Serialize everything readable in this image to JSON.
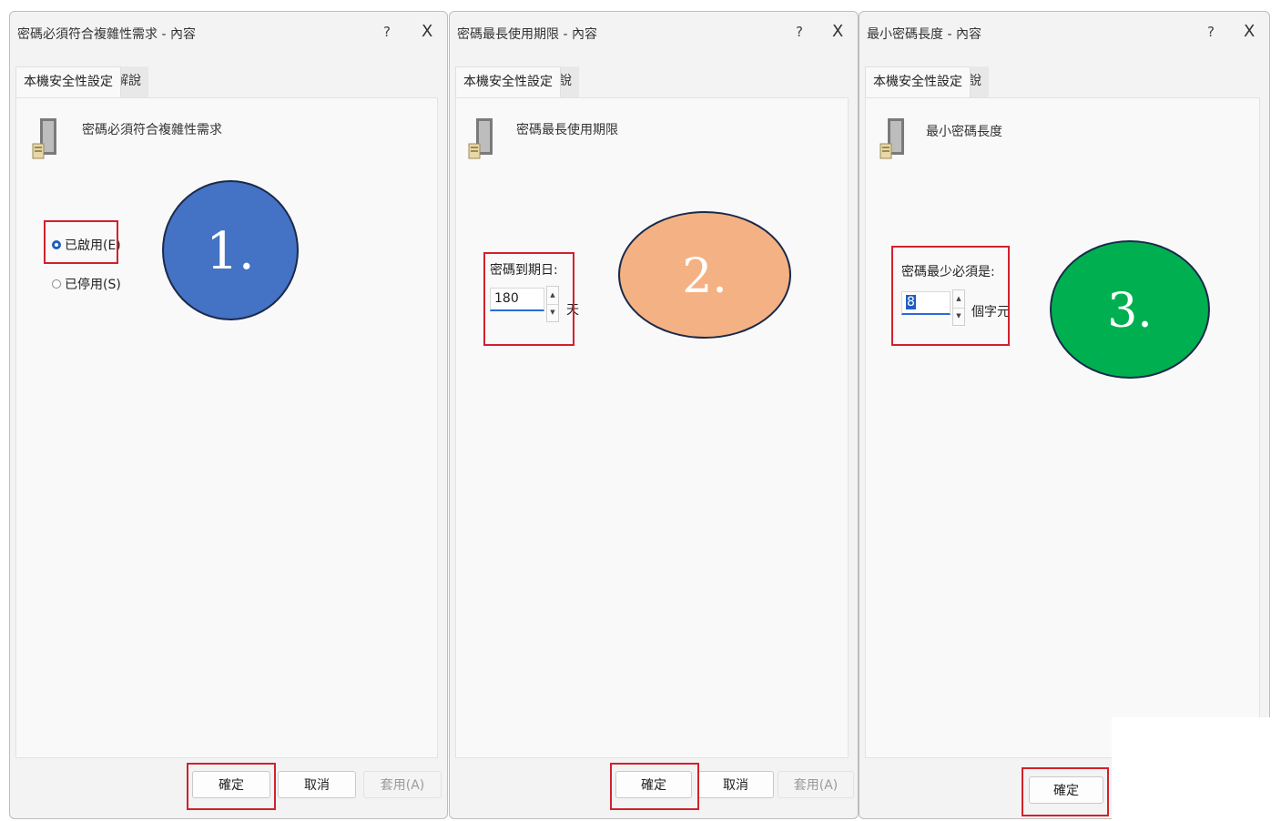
{
  "dialogs": [
    {
      "title": "密碼必須符合複雜性需求 - 內容",
      "help": "?",
      "close": "X",
      "tabs": [
        "本機安全性設定",
        "解說"
      ],
      "policy_name": "密碼必須符合複雜性需求",
      "options": [
        {
          "label": "已啟用(E)",
          "checked": true
        },
        {
          "label": "已停用(S)",
          "checked": false
        }
      ],
      "buttons": {
        "ok": "確定",
        "cancel": "取消",
        "apply": "套用(A)"
      },
      "marker": {
        "label": "1.",
        "color": "#4472c4"
      }
    },
    {
      "title": "密碼最長使用期限 - 內容",
      "help": "?",
      "close": "X",
      "tabs": [
        "本機安全性設定",
        "解說"
      ],
      "policy_name": "密碼最長使用期限",
      "field_label": "密碼到期日:",
      "field_value": "180",
      "unit": "天",
      "buttons": {
        "ok": "確定",
        "cancel": "取消",
        "apply": "套用(A)"
      },
      "marker": {
        "label": "2.",
        "color": "#f4b183"
      }
    },
    {
      "title": "最小密碼長度 - 內容",
      "help": "?",
      "close": "X",
      "tabs": [
        "本機安全性設定",
        "解說"
      ],
      "policy_name": "最小密碼長度",
      "field_label": "密碼最少必須是:",
      "field_value": "8",
      "unit": "個字元",
      "buttons": {
        "ok": "確定"
      },
      "marker": {
        "label": "3.",
        "color": "#00b050"
      }
    }
  ]
}
